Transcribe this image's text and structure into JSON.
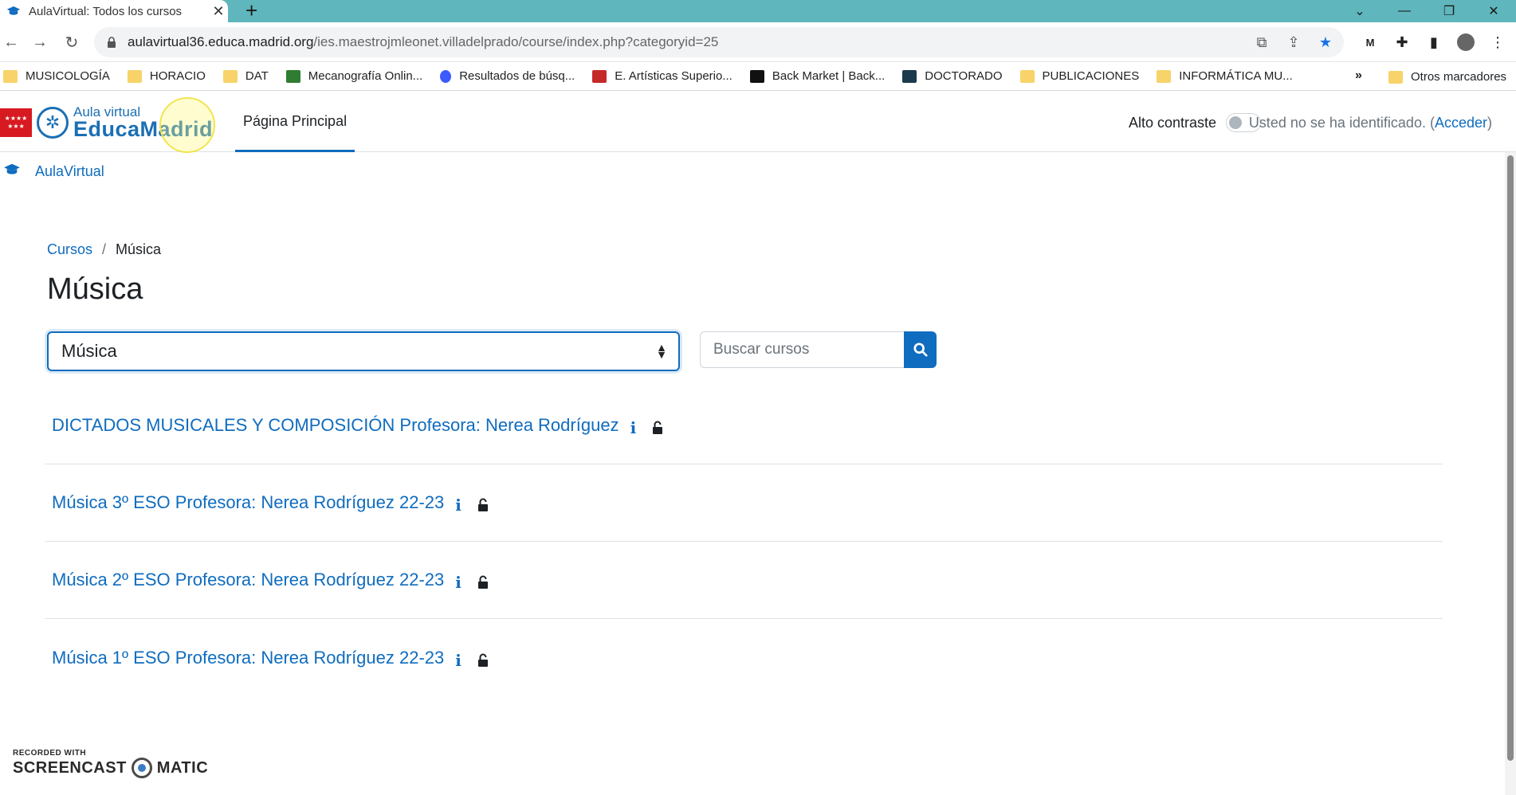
{
  "browser": {
    "tab_title": "AulaVirtual: Todos los cursos",
    "tab_close": "✕",
    "new_tab": "+",
    "url_host": "aulavirtual36.educa.madrid.org",
    "url_path": "/ies.maestrojmleonet.villadelprado/course/index.php?categoryid=25",
    "bookmarks": [
      {
        "label": "MUSICOLOGÍA",
        "icon": "folder-icon"
      },
      {
        "label": "HORACIO",
        "icon": "folder-icon"
      },
      {
        "label": "DAT",
        "icon": "folder-icon"
      },
      {
        "label": "Mecanografía Onlin...",
        "icon": "keyboard-icon"
      },
      {
        "label": "Resultados de búsq...",
        "icon": "search-result-icon"
      },
      {
        "label": "E. Artísticas Superio...",
        "icon": "red-site-icon"
      },
      {
        "label": "Back Market | Back...",
        "icon": "backmarket-icon"
      },
      {
        "label": "DOCTORADO",
        "icon": "university-icon"
      },
      {
        "label": "PUBLICACIONES",
        "icon": "folder-icon"
      },
      {
        "label": "INFORMÁTICA MU...",
        "icon": "folder-icon"
      }
    ],
    "bookmarks_more": "»",
    "other_bookmarks": "Otros marcadores"
  },
  "site": {
    "logo_small": "Aula virtual",
    "logo_big": "EducaMadrid",
    "nav_home": "Página Principal",
    "contrast_label": "Alto contraste",
    "contrast_on": false,
    "login_text": "Usted no se ha identificado. (",
    "login_link": "Acceder",
    "login_close": ")",
    "site_name": "AulaVirtual",
    "accent_color": "#0f6cbf"
  },
  "page": {
    "breadcrumb": {
      "parent": "Cursos",
      "separator": "/",
      "current": "Música"
    },
    "title": "Música",
    "category_select": "Música",
    "search_placeholder": "Buscar cursos",
    "courses": [
      {
        "name": "DICTADOS MUSICALES Y COMPOSICIÓN Profesora: Nerea Rodríguez"
      },
      {
        "name": "Música 3º ESO Profesora: Nerea Rodríguez 22-23"
      },
      {
        "name": "Música 2º ESO Profesora: Nerea Rodríguez 22-23"
      },
      {
        "name": "Música 1º ESO Profesora: Nerea Rodríguez 22-23"
      }
    ],
    "info_glyph": "i"
  },
  "watermark": {
    "small": "RECORDED WITH",
    "left": "SCREENCAST",
    "right": "MATIC"
  }
}
